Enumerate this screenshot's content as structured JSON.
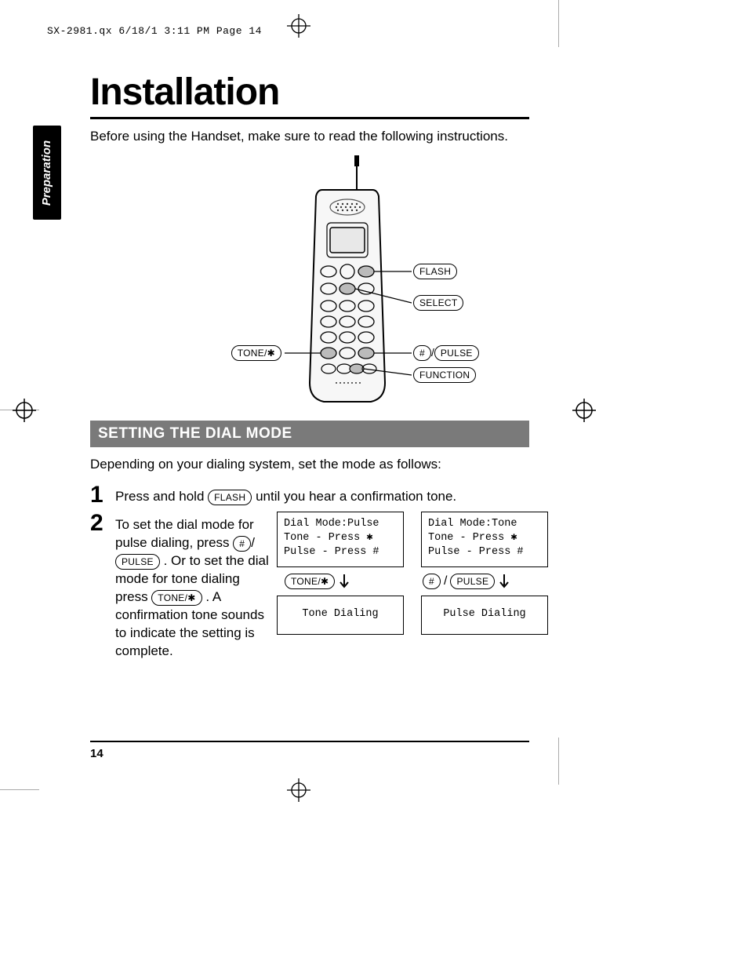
{
  "header_slug": "SX-2981.qx  6/18/1 3:11 PM  Page 14",
  "side_tab": "Preparation",
  "title": "Installation",
  "intro": "Before using the Handset, make sure to read the following instructions.",
  "phone_labels": {
    "flash": "FLASH",
    "select": "SELECT",
    "tone_star": "TONE/✱",
    "hash": "#",
    "pulse": "PULSE",
    "function": "FUNCTION"
  },
  "section_heading": "SETTING THE DIAL MODE",
  "section_intro": "Depending on your dialing system, set the mode as follows:",
  "steps": {
    "one": {
      "num": "1",
      "pre": "Press and hold ",
      "btn": "FLASH",
      "post": " until you hear a confirmation tone."
    },
    "two": {
      "num": "2",
      "pre": "To set the dial mode for pulse dialing, press ",
      "btn1a": "#",
      "btn1b": "PULSE",
      "mid": " .  Or to set the dial mode for tone dialing press ",
      "btn2": "TONE/✱",
      "post": " . A confirmation tone sounds to indicate the setting is complete."
    }
  },
  "screens": {
    "left": {
      "line1": "Dial Mode:Pulse",
      "line2": "Tone  - Press ✱",
      "line3": "Pulse - Press #",
      "mid_btn": "TONE/✱",
      "result": "Tone Dialing"
    },
    "right": {
      "line1": "Dial Mode:Tone",
      "line2": "Tone  - Press ✱",
      "line3": "Pulse - Press #",
      "mid_btn_a": "#",
      "mid_btn_b": "PULSE",
      "result": "Pulse Dialing"
    }
  },
  "page_number": "14"
}
